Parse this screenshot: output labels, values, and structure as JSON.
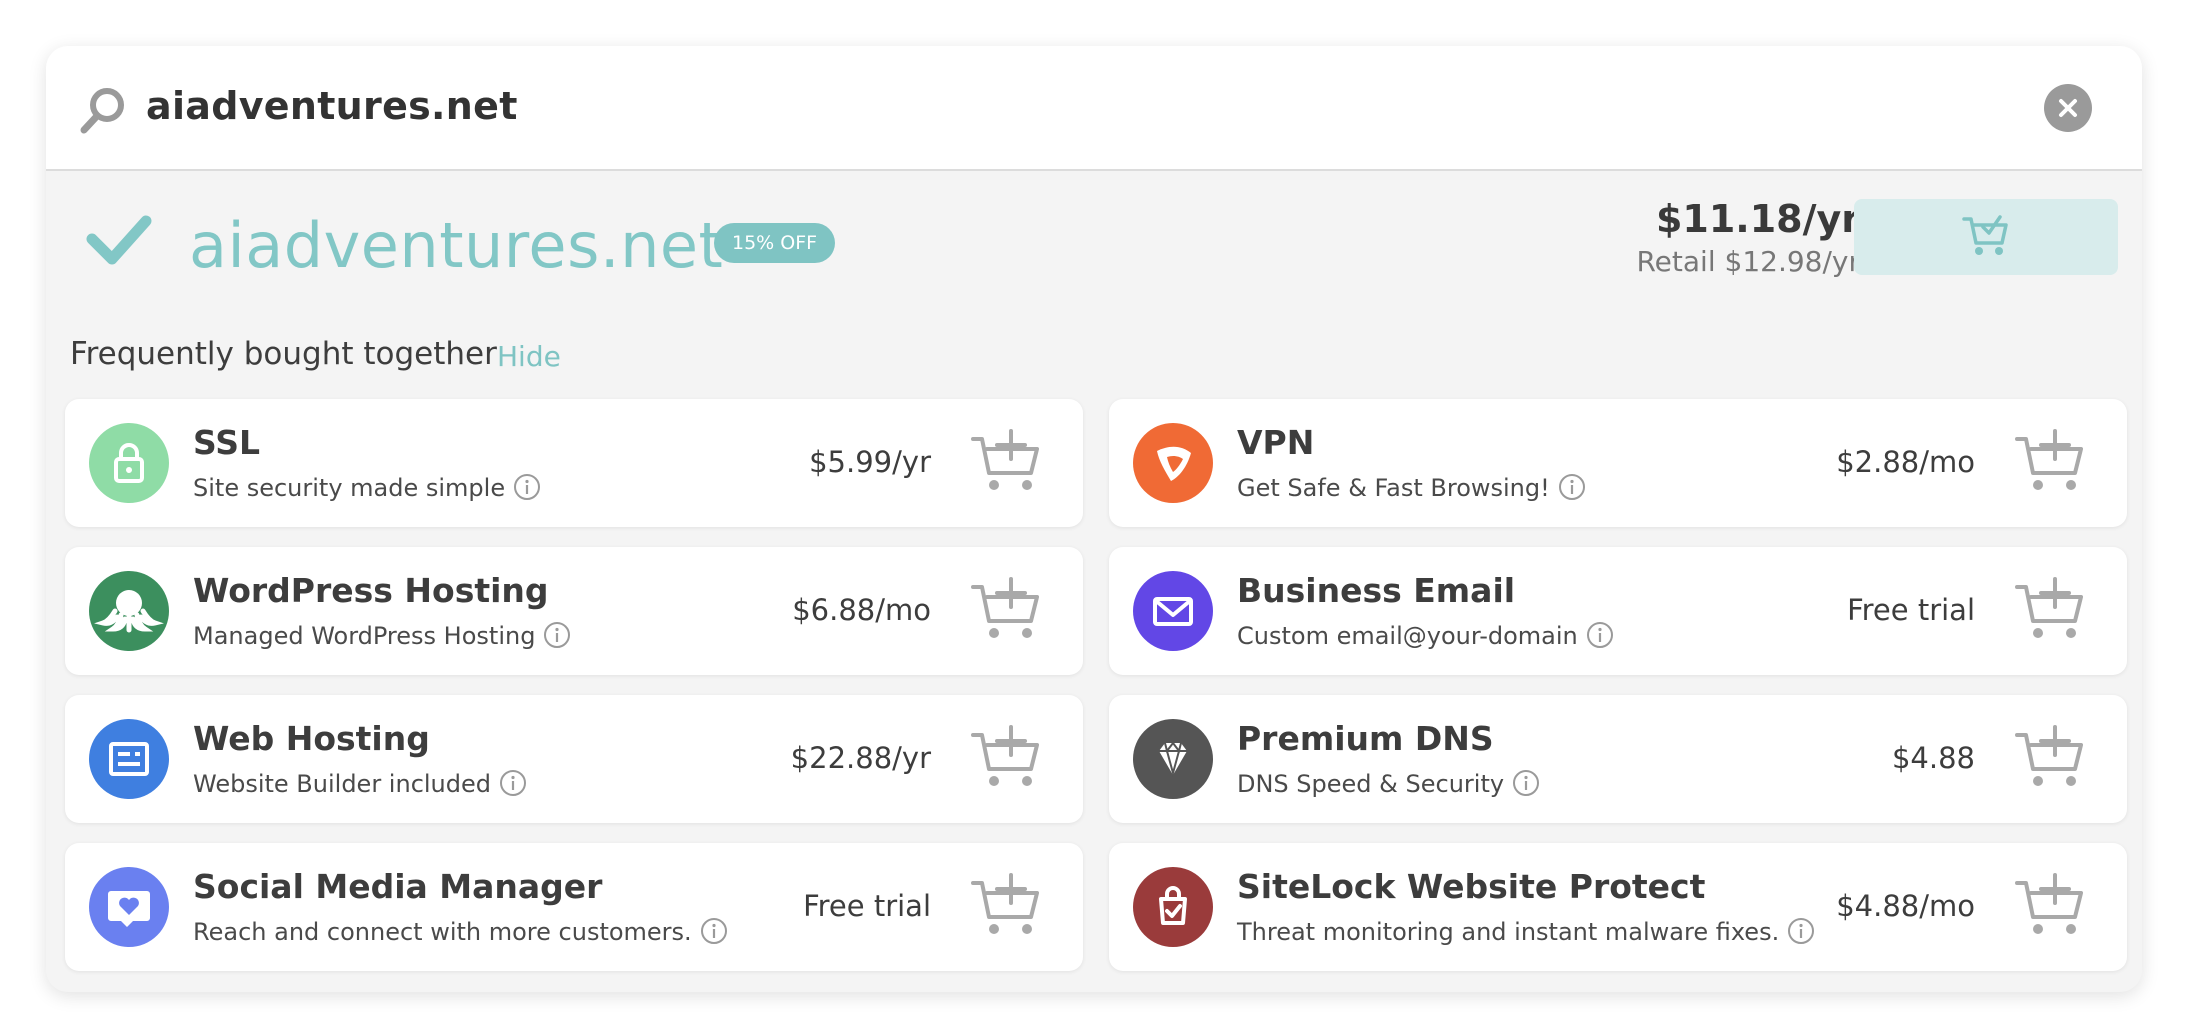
{
  "search": {
    "query": "aiadventures.net"
  },
  "result": {
    "domain": "aiadventures.net",
    "badge": "15% OFF",
    "price": "$11.18/yr",
    "retail": "Retail $12.98/yr"
  },
  "frequently_bought": {
    "title": "Frequently bought together",
    "hide_label": "Hide",
    "items": [
      {
        "name": "SSL",
        "description": "Site security made simple",
        "price": "$5.99/yr",
        "icon": "lock-icon",
        "color": "#8fdca6"
      },
      {
        "name": "VPN",
        "description": "Get Safe & Fast Browsing!",
        "price": "$2.88/mo",
        "icon": "vpn-shield-icon",
        "color": "#f06a35"
      },
      {
        "name": "WordPress Hosting",
        "description": "Managed WordPress Hosting",
        "price": "$6.88/mo",
        "icon": "octopus-icon",
        "color": "#3c8f5e"
      },
      {
        "name": "Business Email",
        "description": "Custom email@your-domain",
        "price": "Free trial",
        "icon": "envelope-icon",
        "color": "#6247e6"
      },
      {
        "name": "Web Hosting",
        "description": "Website Builder included",
        "price": "$22.88/yr",
        "icon": "website-icon",
        "color": "#3f7fe0"
      },
      {
        "name": "Premium DNS",
        "description": "DNS Speed & Security",
        "price": "$4.88",
        "icon": "diamond-icon",
        "color": "#555555"
      },
      {
        "name": "Social Media Manager",
        "description": "Reach and connect with more customers.",
        "price": "Free trial",
        "icon": "heart-chat-icon",
        "color": "#6a80f0"
      },
      {
        "name": "SiteLock Website Protect",
        "description": "Threat monitoring and instant malware fixes.",
        "price": "$4.88/mo",
        "icon": "shield-check-icon",
        "color": "#9a3b3b"
      }
    ]
  }
}
